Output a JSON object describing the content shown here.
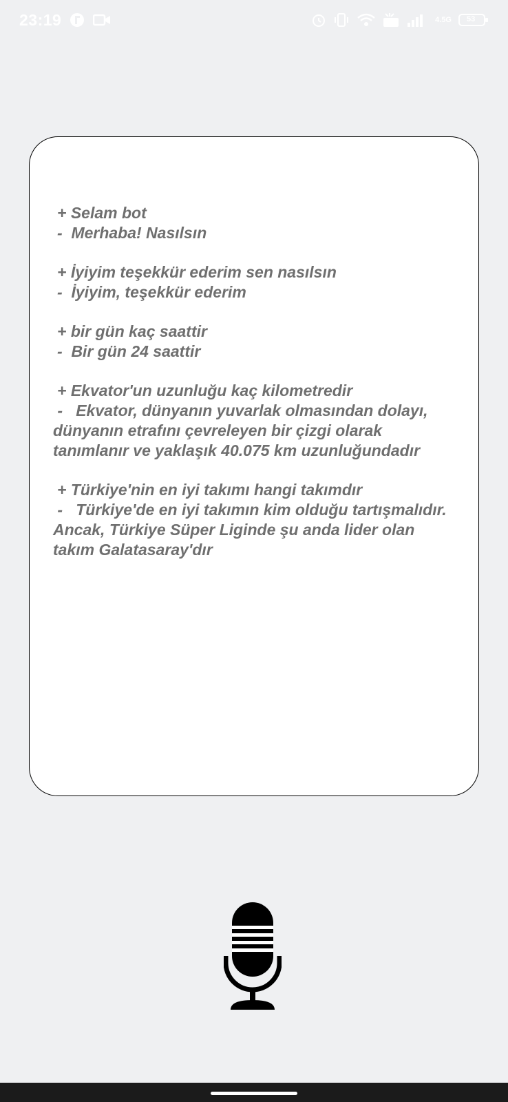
{
  "status_bar": {
    "time": "23:19",
    "battery": "53",
    "network": "4.5G",
    "icons": [
      "app-notification-icon",
      "video-icon",
      "alarm-icon",
      "vibrate-icon",
      "wifi-icon",
      "volte-icon",
      "signal-icon",
      "battery-icon"
    ]
  },
  "chat": {
    "messages": [
      {
        "user": "+ Selam bot",
        "bot": "-  Merhaba! Nasılsın"
      },
      {
        "user": "+ İyiyim teşekkür ederim sen nasılsın",
        "bot": "-  İyiyim, teşekkür ederim"
      },
      {
        "user": "+ bir gün kaç saattir",
        "bot": "-  Bir gün 24 saattir"
      },
      {
        "user": "+ Ekvator'un uzunluğu kaç kilometredir",
        "bot": " -   Ekvator, dünyanın yuvarlak olmasından dolayı, dünyanın etrafını çevreleyen bir çizgi olarak tanımlanır ve yaklaşık 40.075 km uzunluğundadır"
      },
      {
        "user": "+ Türkiye'nin en iyi takımı hangi takımdır",
        "bot": " -   Türkiye'de en iyi takımın kim olduğu tartışmalıdır. Ancak, Türkiye Süper Liginde şu anda lider olan takım Galatasaray'dır"
      }
    ]
  },
  "mic": {
    "icon": "microphone-icon"
  },
  "colors": {
    "background": "#eff0f2",
    "card": "#ffffff",
    "text": "#6f6f6f",
    "mic": "#000000",
    "nav_bar": "#1b1b1b"
  }
}
